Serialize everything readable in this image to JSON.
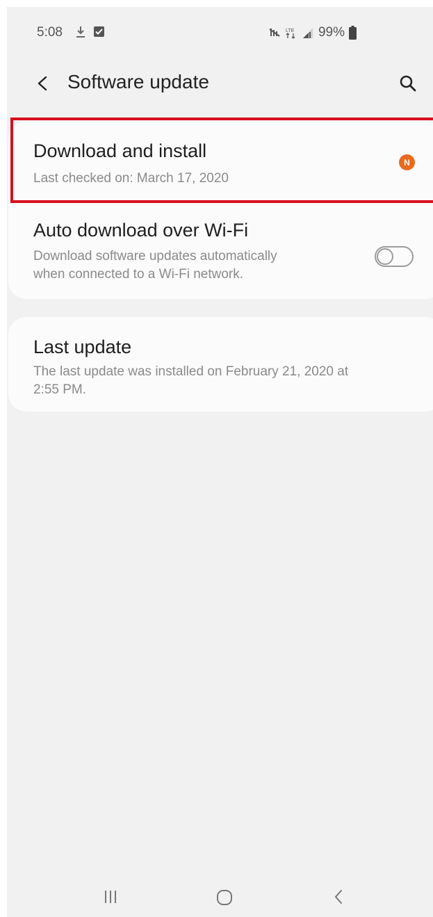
{
  "status_bar": {
    "time": "5:08",
    "battery": "99%",
    "icons": [
      "download-icon",
      "checkbox-notification-icon",
      "mute-icon",
      "lte-icon",
      "signal-icon",
      "battery-icon"
    ]
  },
  "header": {
    "title": "Software update",
    "back_icon": "back-arrow-icon",
    "search_icon": "search-icon"
  },
  "settings": {
    "download_install": {
      "title": "Download and install",
      "subtitle": "Last checked on: March 17, 2020",
      "badge": "N",
      "badge_color": "#ea6a1c"
    },
    "auto_download": {
      "title": "Auto download over Wi-Fi",
      "subtitle_line1": "Download software updates automatically",
      "subtitle_line2": "when connected to a Wi-Fi network.",
      "toggle_on": false
    },
    "last_update": {
      "title": "Last update",
      "subtitle_line1": "The last update was installed on February 21, 2020 at",
      "subtitle_line2": "2:55 PM."
    }
  },
  "highlight_color": "#d9101e",
  "nav_bar": {
    "icons": [
      "recent-apps-icon",
      "home-icon",
      "back-nav-icon"
    ]
  }
}
